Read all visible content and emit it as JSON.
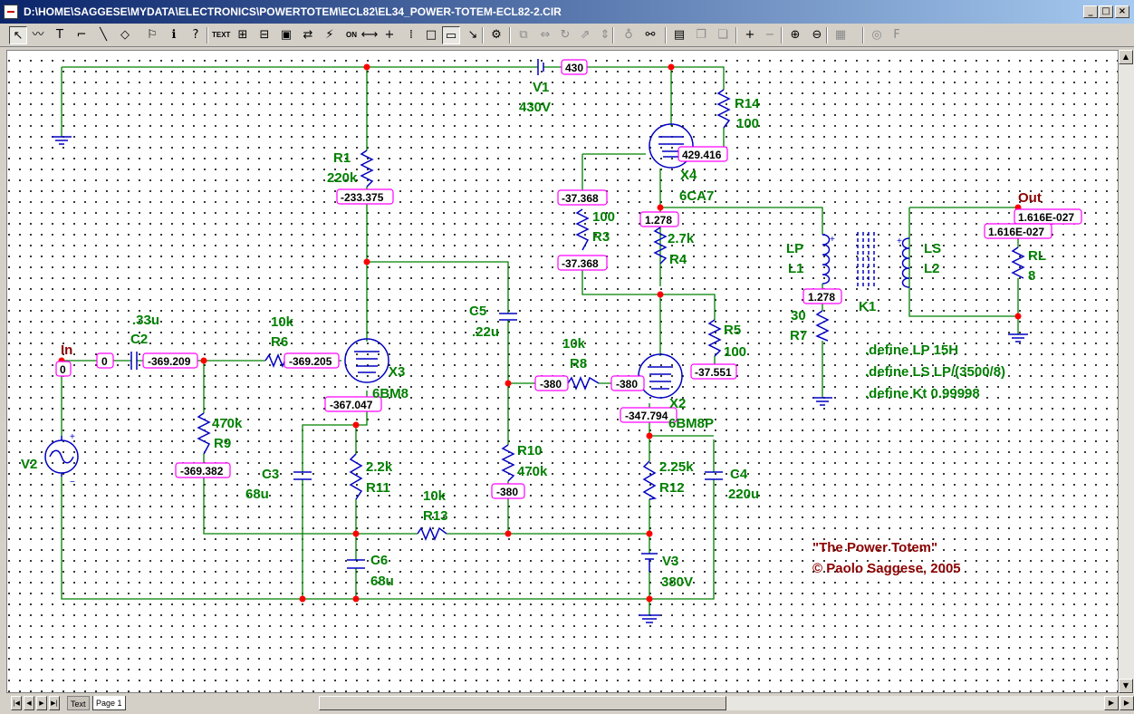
{
  "window": {
    "title": "D:\\HOME\\SAGGESE\\MYDATA\\ELECTRONICS\\POWERTOTEM\\ECL82\\EL34_POWER-TOTEM-ECL82-2.CIR",
    "buttons": {
      "minimize": "_",
      "maximize": "□",
      "close": "×"
    }
  },
  "toolbar": {
    "items": [
      {
        "name": "select-icon",
        "glyph": "↖"
      },
      {
        "name": "wire-icon",
        "glyph": "〰"
      },
      {
        "name": "text-icon",
        "glyph": "T"
      },
      {
        "name": "ortho-wire-icon",
        "glyph": "⌐"
      },
      {
        "name": "line-icon",
        "glyph": "╲"
      },
      {
        "name": "shapes-icon",
        "glyph": "◇"
      },
      {
        "name": "flag-icon",
        "glyph": "⚐"
      },
      {
        "name": "info-icon",
        "glyph": "ℹ"
      },
      {
        "name": "help-icon",
        "glyph": "?"
      },
      {
        "name": "text-mode-icon",
        "glyph": "TEXT"
      },
      {
        "name": "grid-text-icon",
        "glyph": "⊞"
      },
      {
        "name": "pin-icon",
        "glyph": "⊟"
      },
      {
        "name": "node-numbers-icon",
        "glyph": "▣"
      },
      {
        "name": "current-icon",
        "glyph": "⇄"
      },
      {
        "name": "power-icon",
        "glyph": "⚡"
      },
      {
        "name": "on-state-icon",
        "glyph": "ON"
      },
      {
        "name": "pin-connect-icon",
        "glyph": "⟷"
      },
      {
        "name": "cross-icon",
        "glyph": "+"
      },
      {
        "name": "grid-icon",
        "glyph": "⁞"
      },
      {
        "name": "border-icon",
        "glyph": "□"
      },
      {
        "name": "title-icon",
        "glyph": "▭"
      },
      {
        "name": "pointer-mode-icon",
        "glyph": "↘"
      },
      {
        "name": "properties-icon",
        "glyph": "⚙"
      },
      {
        "name": "step-icon",
        "glyph": "⧉"
      },
      {
        "name": "flip-icon",
        "glyph": "⇔"
      },
      {
        "name": "rotate-icon",
        "glyph": "↻"
      },
      {
        "name": "mirror-icon",
        "glyph": "⇗"
      },
      {
        "name": "flip-y-icon",
        "glyph": "⇕"
      },
      {
        "name": "find-icon",
        "glyph": "♁"
      },
      {
        "name": "binoculars-icon",
        "glyph": "⚯"
      },
      {
        "name": "page-scroll-icon",
        "glyph": "▤"
      },
      {
        "name": "front-icon",
        "glyph": "❐"
      },
      {
        "name": "back-icon",
        "glyph": "❏"
      },
      {
        "name": "add-page-icon",
        "glyph": "+"
      },
      {
        "name": "delete-page-icon",
        "glyph": "−"
      },
      {
        "name": "zoom-in-icon",
        "glyph": "⊕"
      },
      {
        "name": "zoom-out-icon",
        "glyph": "⊖"
      },
      {
        "name": "analysis-icon",
        "glyph": "▦"
      },
      {
        "name": "globe-icon",
        "glyph": "◎"
      },
      {
        "name": "font-icon",
        "glyph": "F"
      }
    ]
  },
  "schematic": {
    "labels": {
      "v1_name": "V1",
      "v1_value": "430V",
      "r14_name": "R14",
      "r14_value": "100",
      "r1_name": "R1",
      "r1_value": "220k",
      "x4_name": "X4",
      "x4_value": "6CA7",
      "r3_value": "100",
      "r3_name": "R3",
      "r4_value": "2.7k",
      "r4_name": "R4",
      "out_name": "Out",
      "lp_name": "LP",
      "l1_name": "L1",
      "ls_name": "LS",
      "l2_name": "L2",
      "rl_name": "RL",
      "rl_value": "8",
      "k1_name": "K1",
      "r7_value": "30",
      "r7_name": "R7",
      "c5_name": "C5",
      "c5_value": ".22u",
      "r5_name": "R5",
      "r5_value": "100",
      "c2_value": ".33u",
      "c2_name": "C2",
      "r6_value": "10k",
      "r6_name": "R6",
      "in_name": "In",
      "x3_name": "X3",
      "x3_value": "6BM8",
      "r8_value": "10k",
      "r8_name": "R8",
      "x2_name": "X2",
      "x2_value": "6BM8P",
      "r9_value": "470k",
      "r9_name": "R9",
      "v2_name": "V2",
      "c3_name": "C3",
      "c3_value": "68u",
      "r11_value": "2.2k",
      "r11_name": "R11",
      "r10_name": "R10",
      "r10_value": "470k",
      "r12_value": "2.25k",
      "r12_name": "R12",
      "c4_name": "C4",
      "c4_value": "220u",
      "r13_value": "10k",
      "r13_name": "R13",
      "c6_name": "C6",
      "c6_value": "68u",
      "v3_name": "V3",
      "v3_value": "380V",
      "define1": ".define LP 15H",
      "define2": ".define LS LP/(3500/8)",
      "define3": ".define Kt 0.99998"
    },
    "node_voltages": {
      "v1": "430",
      "x4_plate": "429.416",
      "r1_bottom": "-233.375",
      "r3_top": "-37.368",
      "r3_bottom": "-37.368",
      "x4_cathode": "1.278",
      "out_top": "1.616E-027",
      "out_rl": "1.616E-027",
      "l1_bottom": "1.278",
      "in": "0",
      "c2_left": "0",
      "c2_right": "-369.209",
      "r6_right": "-369.205",
      "x3_cathode": "-367.047",
      "r8_left": "-380",
      "r8_right": "-380",
      "r5_bottom": "-37.551",
      "x2_cathode": "-347.794",
      "r9_bottom": "-369.382",
      "r10_bottom": "-380"
    },
    "credits": {
      "title": "\"The Power Totem\"",
      "author": "© Paolo Saggese, 2005"
    }
  },
  "tabs": {
    "text": "Text",
    "page1": "Page 1"
  },
  "colors": {
    "wire": "#008000",
    "component": "#0000c0",
    "label": "#008000",
    "node_box": "#ff00ff",
    "junction": "#ff0000",
    "credit": "#8b0000"
  }
}
